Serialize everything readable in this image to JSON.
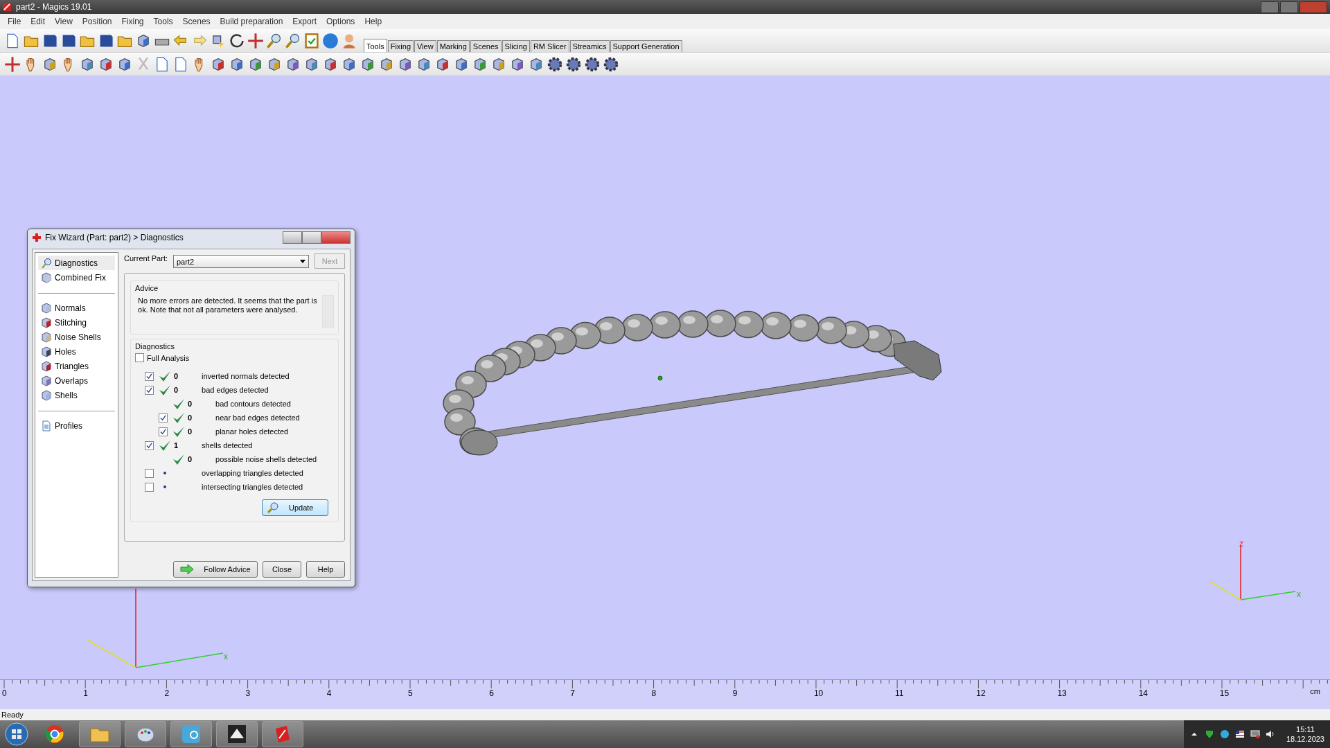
{
  "window": {
    "title": "part2 - Magics 19.01"
  },
  "menu": [
    "File",
    "Edit",
    "View",
    "Position",
    "Fixing",
    "Tools",
    "Scenes",
    "Build preparation",
    "Export",
    "Options",
    "Help"
  ],
  "tabs": [
    {
      "label": "Tools",
      "selected": true
    },
    {
      "label": "Fixing",
      "selected": false
    },
    {
      "label": "View",
      "selected": false
    },
    {
      "label": "Marking",
      "selected": false
    },
    {
      "label": "Scenes",
      "selected": false
    },
    {
      "label": "Slicing",
      "selected": false
    },
    {
      "label": "RM Slicer",
      "selected": false
    },
    {
      "label": "Streamics",
      "selected": false
    },
    {
      "label": "Support Generation",
      "selected": false
    }
  ],
  "viewport": {
    "left_axes": {
      "x_label": "x"
    },
    "right_axes": {
      "z_label": "z",
      "x_label": "x"
    }
  },
  "dialog": {
    "title": "Fix Wizard (Part: part2) > Diagnostics",
    "nav_sections": [
      [
        {
          "label": "Diagnostics",
          "selected": true
        },
        {
          "label": "Combined Fix",
          "selected": false
        }
      ],
      [
        {
          "label": "Normals",
          "selected": false
        },
        {
          "label": "Stitching",
          "selected": false
        },
        {
          "label": "Noise Shells",
          "selected": false
        },
        {
          "label": "Holes",
          "selected": false
        },
        {
          "label": "Triangles",
          "selected": false
        },
        {
          "label": "Overlaps",
          "selected": false
        },
        {
          "label": "Shells",
          "selected": false
        }
      ],
      [
        {
          "label": "Profiles",
          "selected": false
        }
      ]
    ],
    "current_part_label": "Current Part:",
    "current_part": "part2",
    "next_button": {
      "label": "Next",
      "disabled": true
    },
    "advice": {
      "title": "Advice",
      "text": "No more errors are detected. It seems that the part is ok. Note that not all parameters were analysed."
    },
    "diagnostics": {
      "title": "Diagnostics",
      "full_analysis": {
        "label": "Full Analysis",
        "checked": false
      },
      "rows": [
        {
          "kind": "checkbox",
          "checked": true,
          "passed": true,
          "count": "0",
          "label": "inverted normals detected"
        },
        {
          "kind": "checkbox",
          "checked": true,
          "passed": true,
          "count": "0",
          "label": "bad edges detected",
          "children": [
            {
              "kind": "info",
              "passed": true,
              "count": "0",
              "label": "bad contours detected"
            },
            {
              "kind": "checkbox",
              "checked": true,
              "passed": true,
              "count": "0",
              "label": "near bad edges detected"
            },
            {
              "kind": "checkbox",
              "checked": true,
              "passed": true,
              "count": "0",
              "label": "planar holes detected"
            }
          ]
        },
        {
          "kind": "checkbox",
          "checked": true,
          "passed": true,
          "count": "1",
          "label": "shells detected",
          "children": [
            {
              "kind": "info",
              "passed": true,
              "count": "0",
              "label": "possible noise shells detected"
            }
          ]
        },
        {
          "kind": "checkbox",
          "checked": false,
          "passed": false,
          "label": "overlapping triangles detected"
        },
        {
          "kind": "checkbox",
          "checked": false,
          "passed": false,
          "label": "intersecting triangles detected"
        }
      ]
    },
    "update_button": "Update",
    "buttons": [
      "Follow Advice",
      "Close",
      "Help"
    ]
  },
  "ruler": {
    "ticks": [
      "0",
      "1",
      "2",
      "3",
      "4",
      "5",
      "6",
      "7",
      "8",
      "9",
      "10",
      "11",
      "12",
      "13",
      "14",
      "15"
    ],
    "unit": "cm"
  },
  "status_bar": {
    "text": "Ready"
  },
  "taskbar": {
    "time": "15:11",
    "date": "18.12.2023"
  }
}
